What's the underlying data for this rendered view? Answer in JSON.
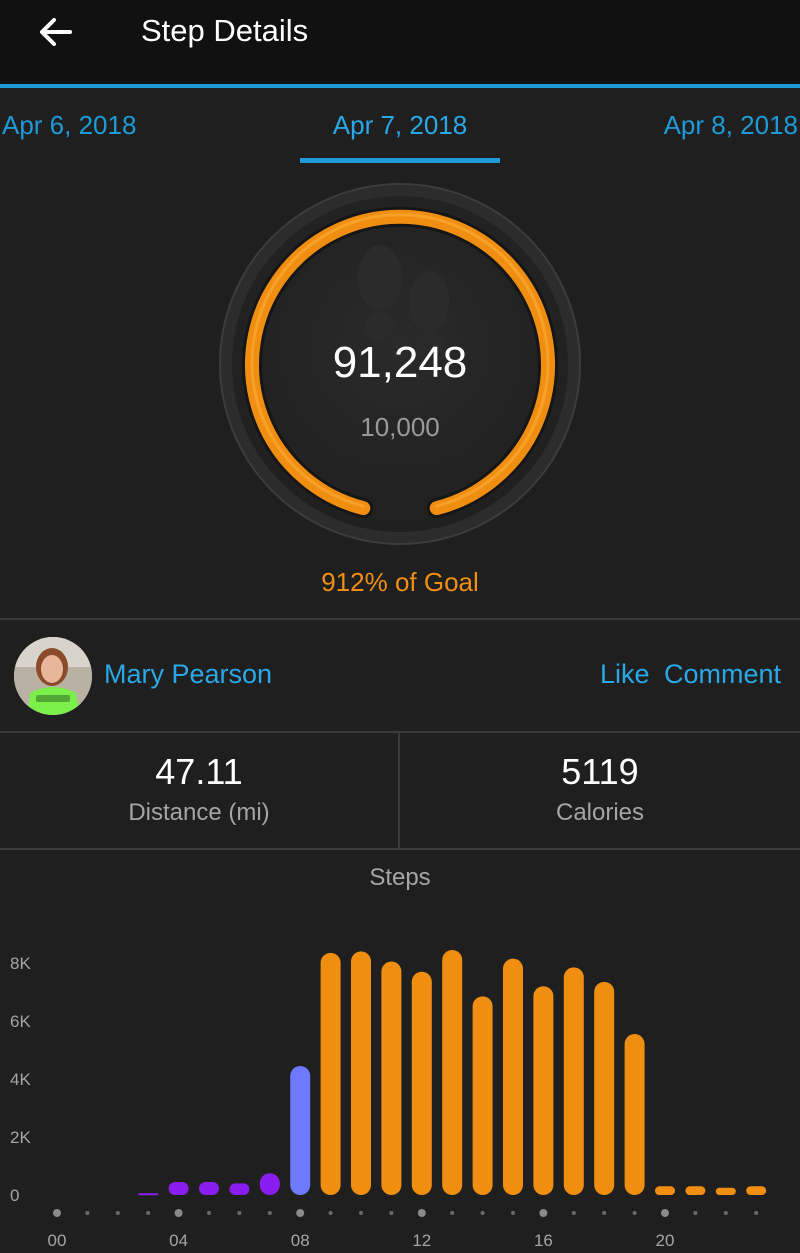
{
  "header": {
    "title": "Step Details",
    "back_icon": "arrow-left-icon"
  },
  "dates": {
    "prev": "Apr 6, 2018",
    "current": "Apr 7, 2018",
    "next": "Apr 8, 2018"
  },
  "summary": {
    "steps": "91,248",
    "goal": "10,000",
    "goal_percent_text": "912% of Goal",
    "goal_fraction": 1.0,
    "ring_color": "#f08e12",
    "center_icon": "footprints-icon"
  },
  "social": {
    "user_name": "Mary Pearson",
    "like_label": "Like",
    "comment_label": "Comment"
  },
  "stats": {
    "distance": {
      "value": "47.11",
      "label": "Distance (mi)"
    },
    "calories": {
      "value": "5119",
      "label": "Calories"
    }
  },
  "colors": {
    "accent": "#1e9bd7",
    "orange": "#f08e12",
    "purple": "#8a1ef0",
    "blue_purple": "#6d79ff"
  },
  "chart_data": {
    "type": "bar",
    "title": "Steps",
    "y_ticks": [
      "0",
      "2K",
      "4K",
      "6K",
      "8K"
    ],
    "ylim": [
      0,
      8800
    ],
    "x_tick_labels": [
      "00",
      "04",
      "08",
      "12",
      "16",
      "20"
    ],
    "categories": [
      "00",
      "01",
      "02",
      "03",
      "04",
      "05",
      "06",
      "07",
      "08",
      "09",
      "10",
      "11",
      "12",
      "13",
      "14",
      "15",
      "16",
      "17",
      "18",
      "19",
      "20",
      "21",
      "22",
      "23"
    ],
    "values": [
      0,
      0,
      0,
      60,
      450,
      450,
      400,
      750,
      4450,
      8350,
      8400,
      8050,
      7700,
      8450,
      6850,
      8150,
      7200,
      7850,
      7350,
      5550,
      300,
      300,
      250,
      300
    ],
    "bar_colors": [
      "#8a1ef0",
      "#8a1ef0",
      "#8a1ef0",
      "#8a1ef0",
      "#8a1ef0",
      "#8a1ef0",
      "#8a1ef0",
      "#8a1ef0",
      "#6d79ff",
      "#f08e12",
      "#f08e12",
      "#f08e12",
      "#f08e12",
      "#f08e12",
      "#f08e12",
      "#f08e12",
      "#f08e12",
      "#f08e12",
      "#f08e12",
      "#f08e12",
      "#f08e12",
      "#f08e12",
      "#f08e12",
      "#f08e12"
    ]
  }
}
